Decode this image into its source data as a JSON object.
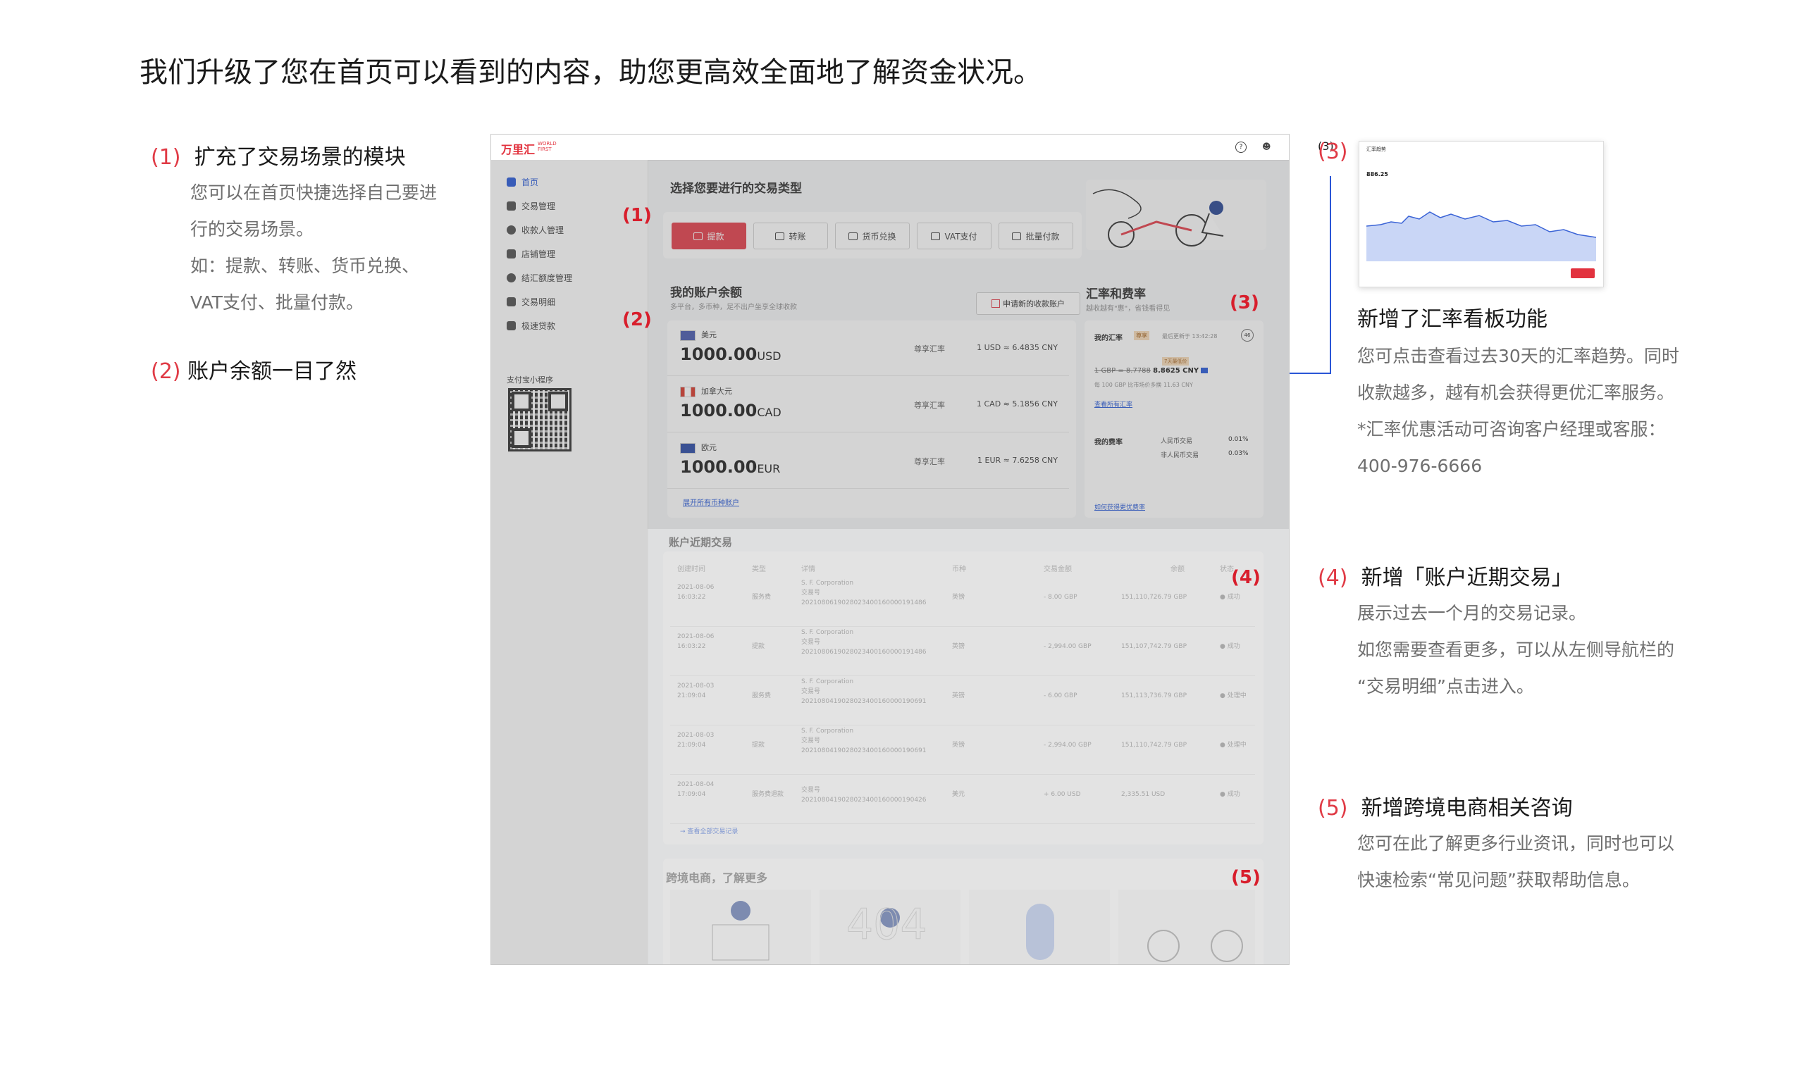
{
  "page_title": "我们升级了您在首页可以看到的内容，助您更高效全面地了解资金状况。",
  "notes": [
    {
      "num": "(1)",
      "title": "扩充了交易场景的模块",
      "lines": [
        "您可以在首页快捷选择自己要进",
        "行的交易场景。",
        "如：提款、转账、货币兑换、",
        "VAT支付、批量付款。"
      ]
    },
    {
      "num": "(2)",
      "title": "账户余额一目了然",
      "lines": []
    },
    {
      "num": "(3)",
      "title": "新增了汇率看板功能",
      "lines": [
        "您可点击查看过去30天的汇率趋势。同时",
        "收款越多，越有机会获得更优汇率服务。",
        "*汇率优惠活动可咨询客户经理或客服：",
        "400-976-6666"
      ]
    },
    {
      "num": "(4)",
      "title": "新增「账户近期交易」",
      "lines": [
        "展示过去一个月的交易记录。",
        "如您需要查看更多，可以从左侧导航栏的",
        "“交易明细”点击进入。"
      ]
    },
    {
      "num": "(5)",
      "title": "新增跨境电商相关咨询",
      "lines": [
        "您可在此了解更多行业资讯，同时也可以",
        "快速检索“常见问题”获取帮助信息。"
      ]
    }
  ],
  "app": {
    "logo": "万里汇",
    "logo_en": "WORLD FIRST",
    "nav": [
      {
        "label": "首页",
        "active": true
      },
      {
        "label": "交易管理",
        "active": false
      },
      {
        "label": "收款人管理",
        "active": false
      },
      {
        "label": "店铺管理",
        "active": false
      },
      {
        "label": "结汇额度管理",
        "active": false
      },
      {
        "label": "交易明细",
        "active": false
      },
      {
        "label": "极速贷款",
        "active": false
      }
    ],
    "qr_label": "支付宝小程序",
    "tx_type_title": "选择您要进行的交易类型",
    "tx_buttons": [
      "提款",
      "转账",
      "货币兑换",
      "VAT支付",
      "批量付款"
    ],
    "balance": {
      "title": "我的账户余额",
      "subtitle": "多平台，多币种，足不出户坐享全球收款",
      "apply_button": "申请新的收款账户",
      "rows": [
        {
          "currency_name": "美元",
          "amount": "1000.00",
          "code": "USD",
          "rate_label": "尊享汇率",
          "rate": "1 USD ≈ 6.4835 CNY",
          "flag_color": "#3c4fa8"
        },
        {
          "currency_name": "加拿大元",
          "amount": "1000.00",
          "code": "CAD",
          "rate_label": "尊享汇率",
          "rate": "1 CAD ≈ 5.1856 CNY",
          "flag_color": "#d52b1e"
        },
        {
          "currency_name": "欧元",
          "amount": "1000.00",
          "code": "EUR",
          "rate_label": "尊享汇率",
          "rate": "1 EUR ≈ 7.6258 CNY",
          "flag_color": "#1d3fa0"
        }
      ],
      "expand_link": "展开所有币种账户"
    },
    "fx": {
      "title": "汇率和费率",
      "subtitle": "越收越有\"惠\"，省钱看得见",
      "my_rate": "我的汇率",
      "badge": "尊享",
      "update": "最后更新于 13:42:28",
      "timer": "46",
      "old_rate": "1 GBP = 8.7788",
      "new_rate": "8.8625 CNY",
      "tag": "7天最低价",
      "saving": "每 100 GBP 比市场价多换 11.63 CNY",
      "all_rates_link": "查看所有汇率",
      "my_fee": "我的费率",
      "fees": [
        {
          "label": "人民币交易",
          "value": "0.01%"
        },
        {
          "label": "非人民币交易",
          "value": "0.03%"
        }
      ],
      "better_link": "如何获得更优费率"
    },
    "recent": {
      "title": "账户近期交易",
      "headers": [
        "创建时间",
        "类型",
        "详情",
        "币种",
        "交易金额",
        "余额",
        "状态"
      ],
      "rows": [
        {
          "time": "2021-08-06\n16:03:22",
          "type": "服务费",
          "party": "S. F. Corporation",
          "detail": "交易号\n2021080619028023400160000191486",
          "cur": "英镑",
          "amount": "- 8.00 GBP",
          "balance": "151,110,726.79 GBP",
          "status": "● 成功"
        },
        {
          "time": "2021-08-06\n16:03:22",
          "type": "提款",
          "party": "S. F. Corporation",
          "detail": "交易号\n2021080619028023400160000191486",
          "cur": "英镑",
          "amount": "- 2,994.00 GBP",
          "balance": "151,107,742.79 GBP",
          "status": "● 成功"
        },
        {
          "time": "2021-08-03\n21:09:04",
          "type": "服务费",
          "party": "S. F. Corporation",
          "detail": "交易号\n2021080419028023400160000190691",
          "cur": "英镑",
          "amount": "- 6.00 GBP",
          "balance": "151,113,736.79 GBP",
          "status": "● 处理中"
        },
        {
          "time": "2021-08-03\n21:09:04",
          "type": "提款",
          "party": "S. F. Corporation",
          "detail": "交易号\n2021080419028023400160000190691",
          "cur": "英镑",
          "amount": "- 2,994.00 GBP",
          "balance": "151,110,742.79 GBP",
          "status": "● 处理中"
        },
        {
          "time": "2021-08-04\n17:09:04",
          "type": "服务费退款",
          "party": "",
          "detail": "交易号\n2021080419028023400160000190426",
          "cur": "美元",
          "amount": "+ 6.00 USD",
          "balance": "2,335.51 USD",
          "status": "● 成功"
        }
      ],
      "more_link": "→ 查看全部交易记录"
    },
    "news": {
      "title": "跨境电商，了解更多"
    }
  },
  "markers": [
    "(1)",
    "(2)",
    "(3)",
    "(4)",
    "(5)"
  ],
  "fx_popup": {
    "title": "汇率趋势",
    "value": "886.25"
  },
  "colors": {
    "accent": "#e2323e",
    "link": "#1a4fd6",
    "marker": "#d81e2c",
    "note_num": "#e03a45"
  }
}
